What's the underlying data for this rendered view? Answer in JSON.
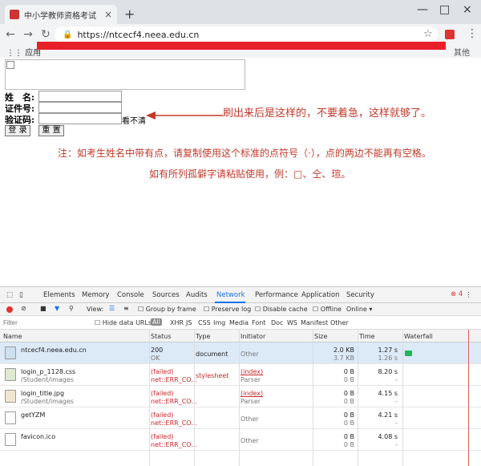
{
  "browser": {
    "tab_title": "中小学教师资格考试",
    "new_tab": "+",
    "tab_close": "×",
    "url": "https://ntcecf4.neea.edu.cn",
    "bookmark_apps": "应用",
    "bookmark_other": "其他",
    "window_controls": [
      "—",
      "□",
      "×"
    ]
  },
  "page": {
    "form": {
      "name_label": "姓　名:",
      "id_label": "证件号:",
      "captcha_label": "验证码:",
      "captcha_hint": "看不清",
      "login_button": "登 录",
      "reset_button": "重 置"
    },
    "notes": {
      "refresh_note": "刷出来后是这样的，不要着急，这样就够了。",
      "dot_note": "注：如考生姓名中带有点，请复制使用这个标准的点符号（·），点的两边不能再有空格。",
      "rare_note": "如有所列孤僻字请粘贴使用，例：□、仝、瑄。"
    },
    "accent_color": "#c0392b"
  },
  "devtools": {
    "tabs": [
      "Elements",
      "Memory",
      "Console",
      "Sources",
      "Audits",
      "Network",
      "Performance",
      "Application",
      "Security"
    ],
    "active_tab": "Network",
    "error_count": "4",
    "toolbar": {
      "view_label": "View:",
      "group_by_frame": "Group by frame",
      "preserve_log": "Preserve log",
      "disable_cache": "Disable cache",
      "offline": "Offline",
      "online": "Online"
    },
    "filter": {
      "placeholder": "Filter",
      "hide_data_urls": "Hide data URLs",
      "types": [
        "All",
        "XHR",
        "JS",
        "CSS",
        "Img",
        "Media",
        "Font",
        "Doc",
        "WS",
        "Manifest",
        "Other"
      ]
    },
    "columns": [
      "Name",
      "Status",
      "Type",
      "Initiator",
      "Size",
      "Time",
      "Waterfall"
    ],
    "rows": [
      {
        "name": "ntcecf4.neea.edu.cn",
        "path": "",
        "status": "200",
        "status2": "OK",
        "type": "document",
        "initiator": "Other",
        "initiator2": "",
        "size": "2.0 KB",
        "size2": "3.7 KB",
        "time": "1.27 s",
        "time2": "1.26 s",
        "icon": "html"
      },
      {
        "name": "login_p_1128.css",
        "path": "/Student/images",
        "status": "(failed)",
        "status2": "net::ERR_CO...",
        "type": "stylesheet",
        "initiator": "(index)",
        "initiator2": "Parser",
        "size": "0 B",
        "size2": "0 B",
        "time": "8.20 s",
        "time2": "-",
        "icon": "css"
      },
      {
        "name": "login_title.jpg",
        "path": "/Student/images",
        "status": "(failed)",
        "status2": "net::ERR_CO...",
        "type": "",
        "initiator": "(index)",
        "initiator2": "Parser",
        "size": "0 B",
        "size2": "0 B",
        "time": "4.15 s",
        "time2": "-",
        "icon": "img"
      },
      {
        "name": "getYZM",
        "path": "",
        "status": "(failed)",
        "status2": "net::ERR_CO...",
        "type": "",
        "initiator": "Other",
        "initiator2": "",
        "size": "0 B",
        "size2": "0 B",
        "time": "4.21 s",
        "time2": "-",
        "icon": "blank"
      },
      {
        "name": "favicon.ico",
        "path": "",
        "status": "(failed)",
        "status2": "net::ERR_CO...",
        "type": "",
        "initiator": "Other",
        "initiator2": "",
        "size": "0 B",
        "size2": "0 B",
        "time": "4.08 s",
        "time2": "-",
        "icon": "blank"
      }
    ]
  }
}
